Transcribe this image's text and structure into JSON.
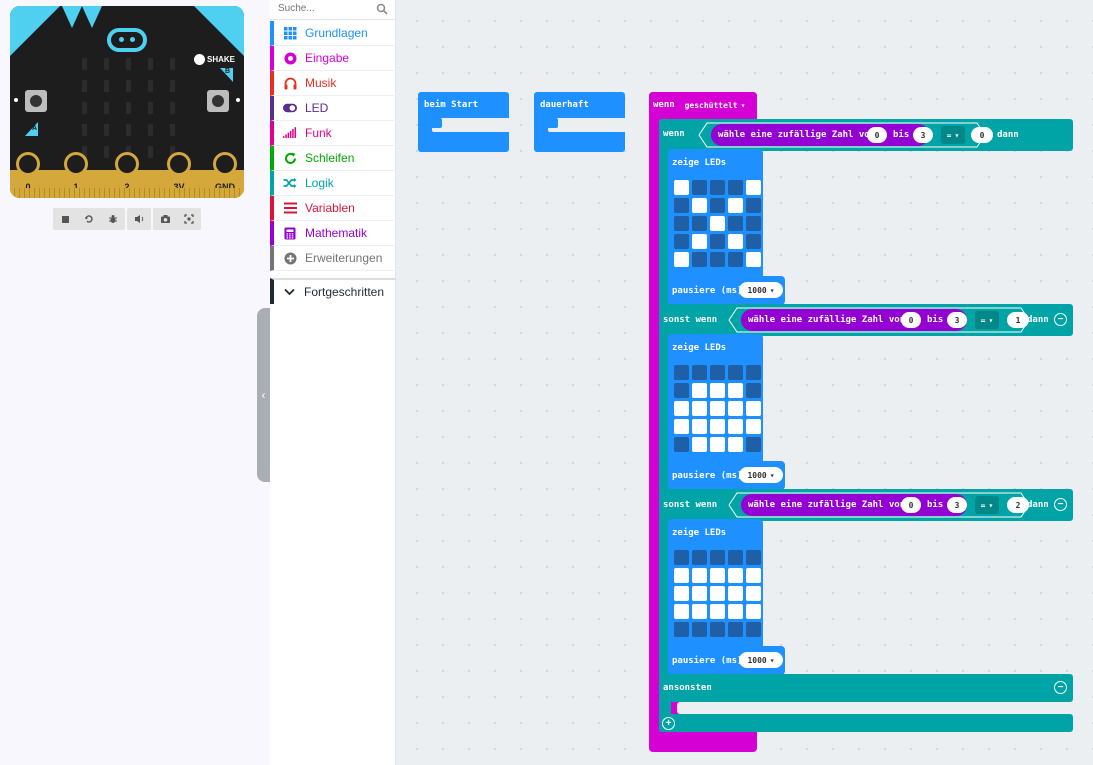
{
  "simulator": {
    "shake_label": "SHAKE",
    "button_a": "A",
    "button_b": "B",
    "pins": [
      "0",
      "1",
      "2",
      "3V",
      "GND"
    ],
    "toolbar_icons": [
      "stop-icon",
      "restart-icon",
      "debug-icon",
      "sound-icon",
      "screenshot-icon",
      "fullscreen-icon"
    ]
  },
  "toolbox": {
    "search_placeholder": "Suche...",
    "categories": [
      {
        "label": "Grundlagen",
        "color": "#1e90ff",
        "icon": "grid-icon"
      },
      {
        "label": "Eingabe",
        "color": "#d400d4",
        "icon": "input-icon"
      },
      {
        "label": "Musik",
        "color": "#e63022",
        "icon": "headphones-icon"
      },
      {
        "label": "LED",
        "color": "#5c2d91",
        "icon": "toggle-icon"
      },
      {
        "label": "Funk",
        "color": "#e3008c",
        "icon": "signal-icon"
      },
      {
        "label": "Schleifen",
        "color": "#00aa00",
        "icon": "loop-icon"
      },
      {
        "label": "Logik",
        "color": "#00a4a6",
        "icon": "shuffle-icon"
      },
      {
        "label": "Variablen",
        "color": "#dc143c",
        "icon": "list-icon"
      },
      {
        "label": "Mathematik",
        "color": "#9400d3",
        "icon": "calculator-icon"
      },
      {
        "label": "Erweiterungen",
        "color": "#757575",
        "icon": "plus-circle-icon"
      }
    ],
    "advanced": {
      "label": "Fortgeschritten",
      "color": "#1d2b33"
    }
  },
  "colors": {
    "basic": "#1e90ff",
    "input": "#d400d4",
    "logic": "#00a4a6",
    "math": "#9400d3"
  },
  "workspace": {
    "on_start": "beim Start",
    "forever": "dauerhaft",
    "event": {
      "label": "wenn",
      "value": "geschüttelt"
    },
    "if_label": "wenn",
    "then_label": "dann",
    "elseif_label": "sonst wenn",
    "else_label": "ansonsten",
    "random_label": "wähle eine zufällige Zahl von",
    "bis_label": "bis",
    "eq_label": "=",
    "show_leds": "zeige LEDs",
    "pause_label": "pausiere (ms)",
    "branches": [
      {
        "from": "0",
        "to": "3",
        "compare": "0",
        "pause": "1000",
        "leds": [
          "10001",
          "01010",
          "00100",
          "01010",
          "10001"
        ]
      },
      {
        "from": "0",
        "to": "3",
        "compare": "1",
        "pause": "1000",
        "leds": [
          "00000",
          "01110",
          "11111",
          "11111",
          "01110"
        ]
      },
      {
        "from": "0",
        "to": "3",
        "compare": "2",
        "pause": "1000",
        "leds": [
          "00000",
          "11111",
          "11111",
          "11111",
          "00000"
        ]
      }
    ]
  }
}
